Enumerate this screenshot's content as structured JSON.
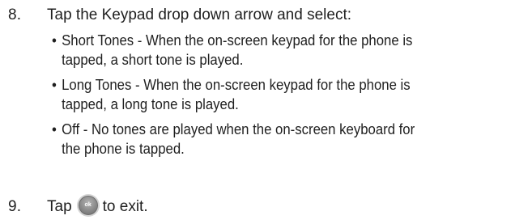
{
  "steps": [
    {
      "number": "8.",
      "text": "Tap the Keypad drop down arrow and select:",
      "bullets": [
        {
          "line1": "Short Tones - When the on-screen keypad for the phone is",
          "line2": "tapped, a short tone is played."
        },
        {
          "line1": "Long Tones - When the on-screen keypad for the phone is",
          "line2": "tapped, a long tone is played."
        },
        {
          "line1": "Off - No tones are played when the on-screen keyboard for",
          "line2": "the phone is tapped."
        }
      ]
    },
    {
      "number": "9.",
      "text_before": "Tap",
      "icon": "ok-button-icon",
      "icon_label": "ok",
      "text_after": "to exit."
    }
  ],
  "bullet_glyph": "•"
}
